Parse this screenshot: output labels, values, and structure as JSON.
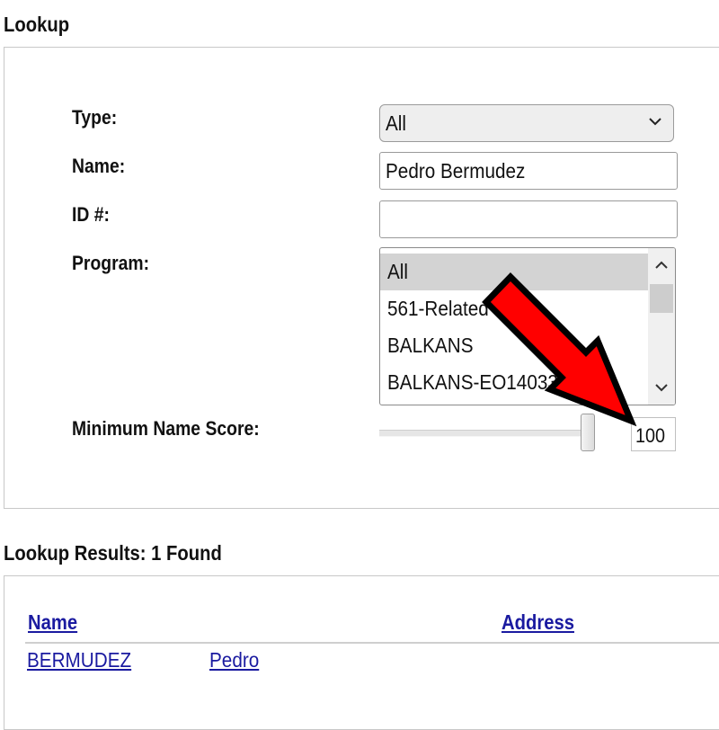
{
  "lookup": {
    "title": "Lookup",
    "type_label": "Type:",
    "type_value": "All",
    "name_label": "Name:",
    "name_value": "Pedro Bermudez",
    "id_label": "ID #:",
    "id_value": "",
    "program_label": "Program:",
    "program_options": [
      {
        "label": "All",
        "selected": true
      },
      {
        "label": "561-Related",
        "selected": false
      },
      {
        "label": "BALKANS",
        "selected": false
      },
      {
        "label": "BALKANS-EO14033",
        "selected": false
      }
    ],
    "score_label": "Minimum Name Score:",
    "score_value": "100",
    "score_level": 100
  },
  "results": {
    "title": "Lookup Results: 1 Found",
    "columns": [
      "Name",
      "Address"
    ],
    "rows": [
      {
        "last_name": "BERMUDEZ",
        "first_name": "Pedro"
      }
    ]
  },
  "annotation": {
    "arrow_color": "#ff0000",
    "outline_color": "#000000",
    "icon": "red-arrow-pointer"
  }
}
